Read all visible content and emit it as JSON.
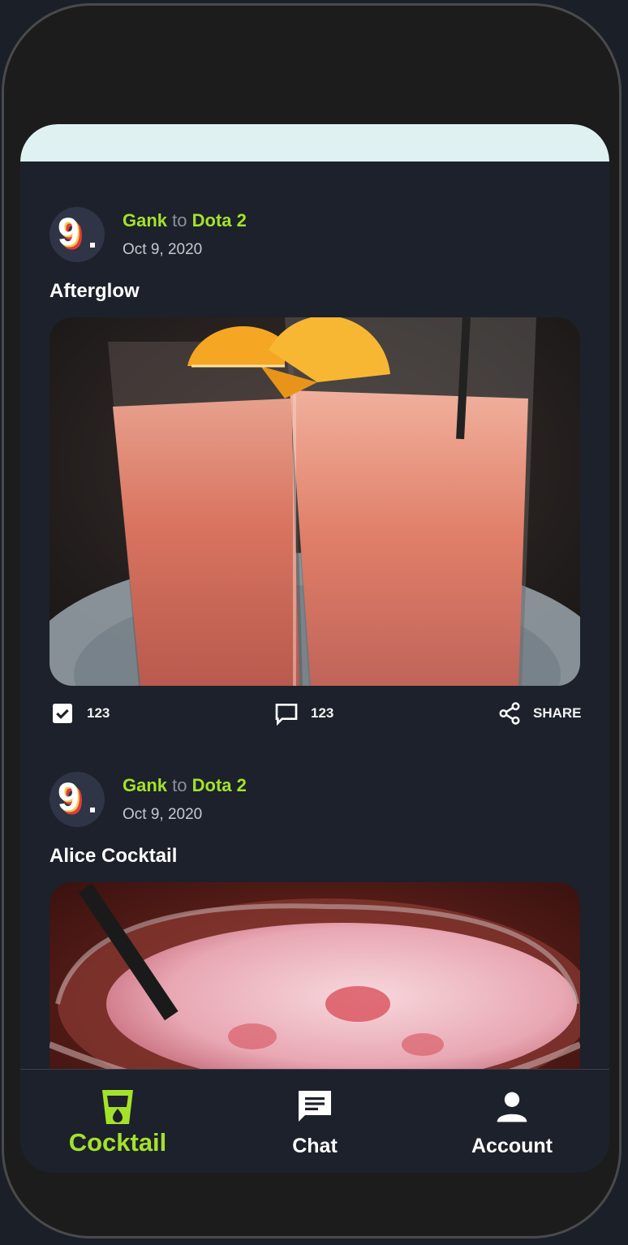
{
  "posts": [
    {
      "user": "Gank",
      "to_word": "to",
      "channel": "Dota 2",
      "date": "Oct 9, 2020",
      "title": "Afterglow",
      "likes": "123",
      "comments": "123",
      "share_label": "SHARE",
      "avatar_letter": "9"
    },
    {
      "user": "Gank",
      "to_word": "to",
      "channel": "Dota 2",
      "date": "Oct 9, 2020",
      "title": "Alice Cocktail",
      "avatar_letter": "9"
    }
  ],
  "nav": {
    "items": [
      {
        "label": "Cocktail",
        "icon": "cocktail-glass-icon",
        "active": true
      },
      {
        "label": "Chat",
        "icon": "chat-bubble-icon",
        "active": false
      },
      {
        "label": "Account",
        "icon": "person-icon",
        "active": false
      }
    ],
    "active_color": "#a4e22a",
    "inactive_color": "#ffffff"
  },
  "colors": {
    "accent": "#a4e22a",
    "background": "#1c212b",
    "header_strip": "#dff2f1"
  }
}
